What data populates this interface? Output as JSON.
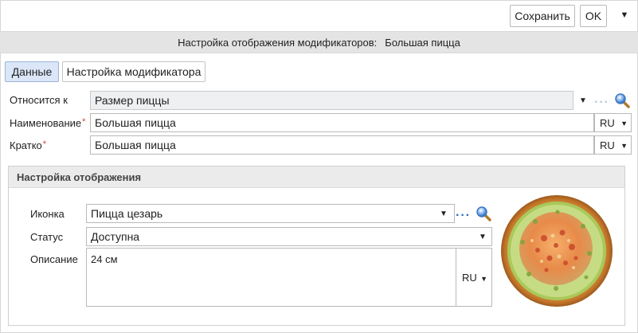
{
  "toolbar": {
    "save_label": "Сохранить",
    "ok_label": "OK",
    "menu_icon": "▼"
  },
  "title": {
    "prefix": "Настройка отображения модификаторов:",
    "name": "Большая пицца"
  },
  "tabs": [
    {
      "label": "Данные",
      "active": true
    },
    {
      "label": "Настройка модификатора",
      "active": false
    }
  ],
  "form": {
    "belongs_to": {
      "label": "Относится к",
      "value": "Размер пиццы"
    },
    "name": {
      "label": "Наименование",
      "value": "Большая пицца",
      "lang": "RU"
    },
    "short": {
      "label": "Кратко",
      "value": "Большая пицца",
      "lang": "RU"
    }
  },
  "display_settings": {
    "header": "Настройка отображения",
    "icon": {
      "label": "Иконка",
      "value": "Пицца цезарь"
    },
    "status": {
      "label": "Статус",
      "value": "Доступна"
    },
    "description": {
      "label": "Описание",
      "value": "24 см",
      "lang": "RU"
    }
  },
  "icons": {
    "dots": "…",
    "search": "search-icon",
    "dropdown": "▼"
  },
  "colors": {
    "accent_blue": "#2f6fc0",
    "required_red": "#d9382d",
    "active_tab": "#dbe7f8"
  }
}
